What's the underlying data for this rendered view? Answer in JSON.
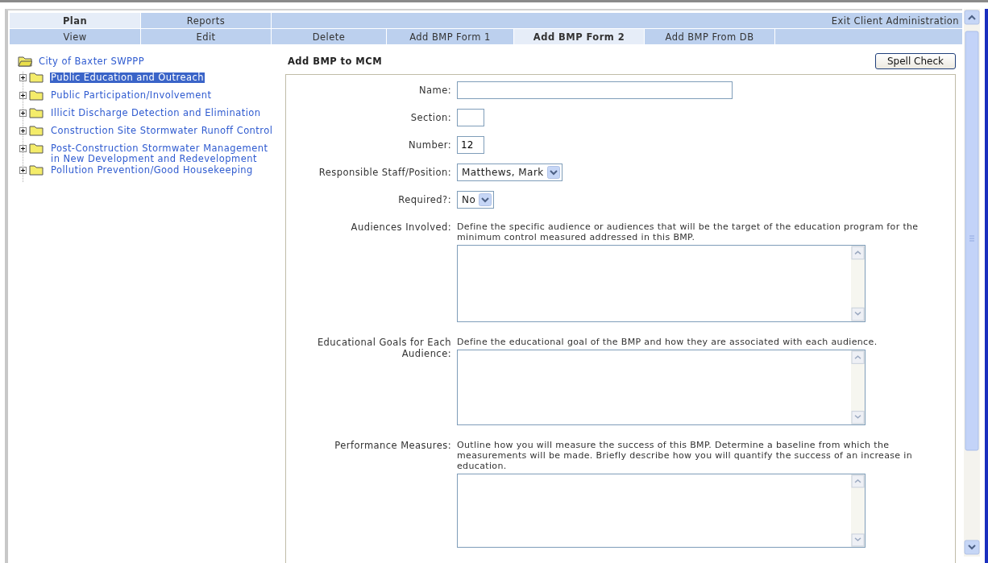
{
  "tabs": [
    {
      "label": "Plan",
      "selected": true
    },
    {
      "label": "Reports",
      "selected": false
    }
  ],
  "exit_link": "Exit Client Administration",
  "subtabs": [
    {
      "label": "View",
      "selected": false
    },
    {
      "label": "Edit",
      "selected": false
    },
    {
      "label": "Delete",
      "selected": false
    },
    {
      "label": "Add BMP Form 1",
      "selected": false
    },
    {
      "label": "Add BMP Form 2",
      "selected": true
    },
    {
      "label": "Add BMP From DB",
      "selected": false
    }
  ],
  "tree": {
    "root": "City of Baxter SWPPP",
    "items": [
      {
        "label": "Public Education and Outreach",
        "selected": true,
        "expanded": false
      },
      {
        "label": "Public Participation/Involvement",
        "selected": false,
        "expanded": false
      },
      {
        "label": "Illicit Discharge Detection and Elimination",
        "selected": false,
        "expanded": false
      },
      {
        "label": "Construction Site Stormwater Runoff Control",
        "selected": false,
        "expanded": false
      },
      {
        "label": "Post-Construction Stormwater Management in New Development and Redevelopment",
        "selected": false,
        "expanded": false
      },
      {
        "label": "Pollution Prevention/Good Housekeeping",
        "selected": false,
        "expanded": false
      }
    ]
  },
  "form": {
    "title": "Add BMP to MCM",
    "spell_check": "Spell Check",
    "fields": [
      {
        "kind": "longtext",
        "label": "Name:"
      },
      {
        "kind": "shorttext",
        "label": "Section:"
      },
      {
        "kind": "shorttext",
        "label": "Number:",
        "value": "12"
      },
      {
        "kind": "select",
        "label": "Responsible Staff/Position:",
        "value": "Matthews, Mark"
      },
      {
        "kind": "select",
        "label": "Required?:",
        "value": "No"
      },
      {
        "kind": "textarea",
        "label": "Audiences Involved:",
        "description": "Define the specific audience or audiences that will be the target of the education program for the minimum control measured addressed in this BMP."
      },
      {
        "kind": "textarea",
        "label": "Educational Goals for Each Audience:",
        "description": "Define the educational goal of the BMP and how they are associated with each audience."
      },
      {
        "kind": "textarea",
        "label": "Performance Measures:",
        "description": "Outline how you will measure the success of this BMP. Determine a baseline from which the measurements will be made. Briefly describe how you will quantify the success of an increase in education."
      }
    ]
  }
}
